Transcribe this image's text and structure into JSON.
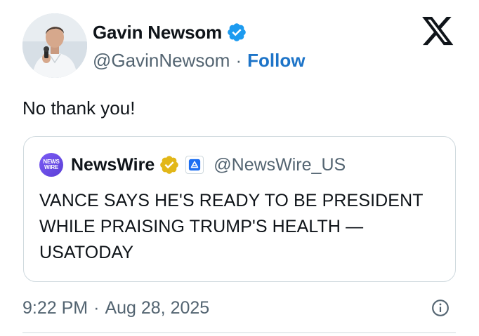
{
  "author": {
    "name": "Gavin Newsom",
    "handle": "@GavinNewsom",
    "separator": "·",
    "follow_label": "Follow",
    "verified_color": "#1d9bf0"
  },
  "tweet": {
    "text": "No thank you!"
  },
  "quoted": {
    "avatar_text_line1": "NEWS",
    "avatar_text_line2": "WIRE",
    "name": "NewsWire",
    "handle": "@NewsWire_US",
    "badge_color": "#e2b719",
    "body": "VANCE SAYS HE'S READY TO BE PRESIDENT WHILE PRAISING TRUMP'S HEALTH — USATODAY"
  },
  "footer": {
    "time": "9:22 PM",
    "separator": "·",
    "date": "Aug 28, 2025"
  },
  "icons": {
    "logo": "x-logo-icon",
    "info": "info-icon"
  },
  "colors": {
    "link": "#1d74c8",
    "secondary_text": "#536471",
    "border": "#cfd9de"
  }
}
